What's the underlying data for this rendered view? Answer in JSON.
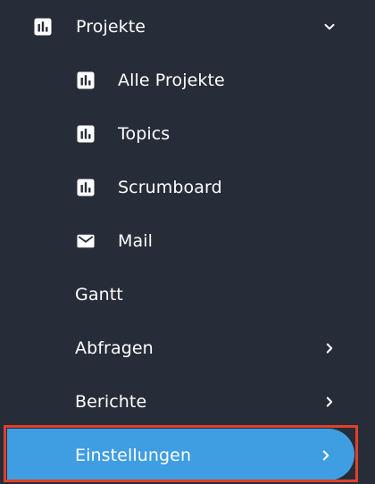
{
  "menu": {
    "projects": {
      "label": "Projekte",
      "icon": "bar-chart-icon",
      "expanded": true,
      "children": [
        {
          "label": "Alle Projekte",
          "icon": "bar-chart-icon"
        },
        {
          "label": "Topics",
          "icon": "bar-chart-icon"
        },
        {
          "label": "Scrumboard",
          "icon": "bar-chart-icon"
        },
        {
          "label": "Mail",
          "icon": "mail-icon"
        }
      ]
    },
    "gantt": {
      "label": "Gantt"
    },
    "queries": {
      "label": "Abfragen"
    },
    "reports": {
      "label": "Berichte"
    },
    "settings": {
      "label": "Einstellungen",
      "active": true
    }
  },
  "colors": {
    "background": "#272d38",
    "active": "#3f9de2",
    "highlight_border": "#e0402c",
    "text": "#ffffff"
  }
}
